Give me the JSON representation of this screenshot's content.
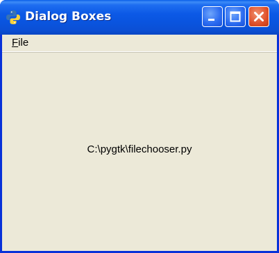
{
  "window": {
    "title": "Dialog Boxes",
    "icon": "python-icon",
    "title_colors": {
      "bar": "#0a55e0",
      "close": "#e0502a"
    },
    "buttons": {
      "minimize_icon": "minimize-icon",
      "maximize_icon": "maximize-icon",
      "close_icon": "close-icon"
    }
  },
  "menubar": {
    "items": [
      {
        "label": "File",
        "mnemonic": "F",
        "rest": "ile"
      }
    ]
  },
  "main": {
    "label": "C:\\pygtk\\filechooser.py"
  }
}
